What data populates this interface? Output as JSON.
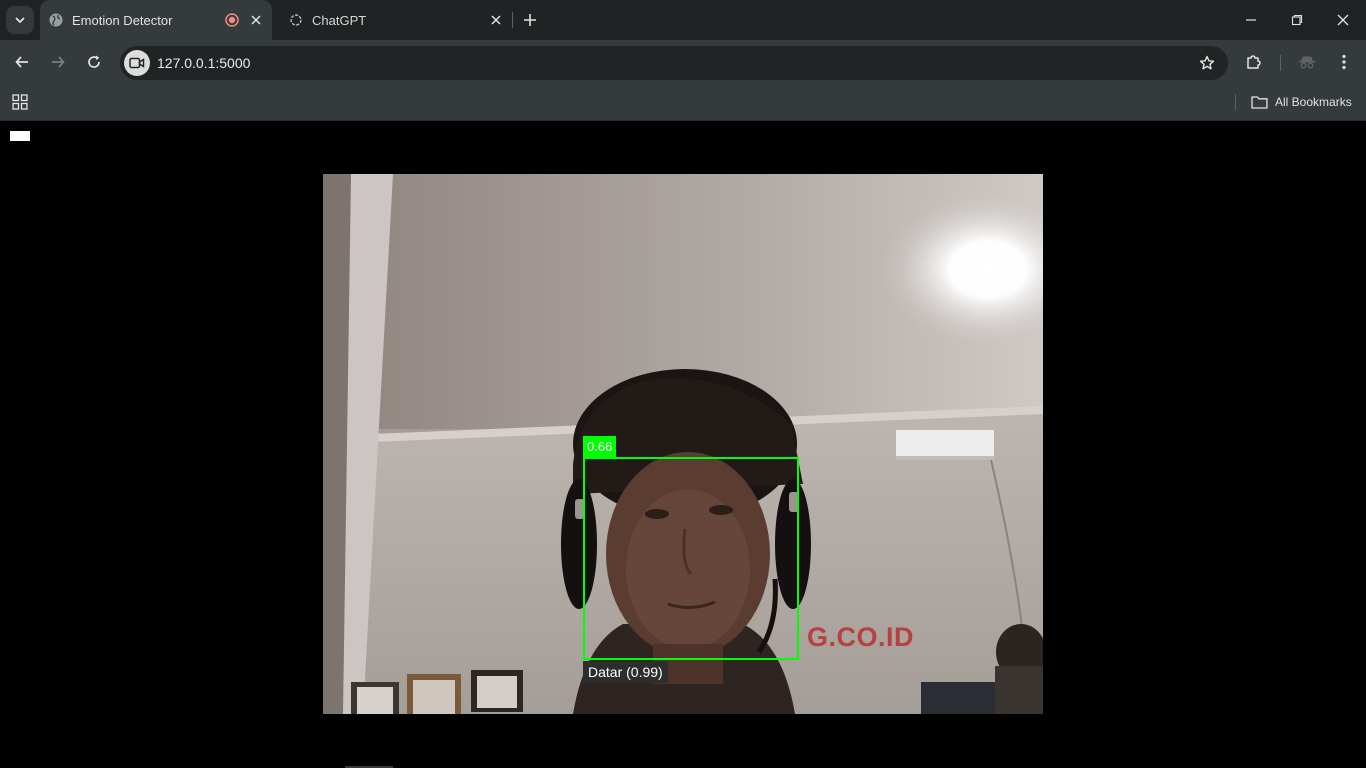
{
  "browser": {
    "tabs": [
      {
        "title": "Emotion Detector",
        "active": true,
        "recording": true
      },
      {
        "title": "ChatGPT",
        "active": false
      }
    ],
    "url": "127.0.0.1:5000",
    "bookmarks": {
      "all_label": "All Bookmarks"
    }
  },
  "page": {
    "detection": {
      "confidence_label": "0.66",
      "emotion_label": "Datar (0.99)",
      "box_color": "#00ff00"
    },
    "scene_text": "G.CO.ID"
  }
}
